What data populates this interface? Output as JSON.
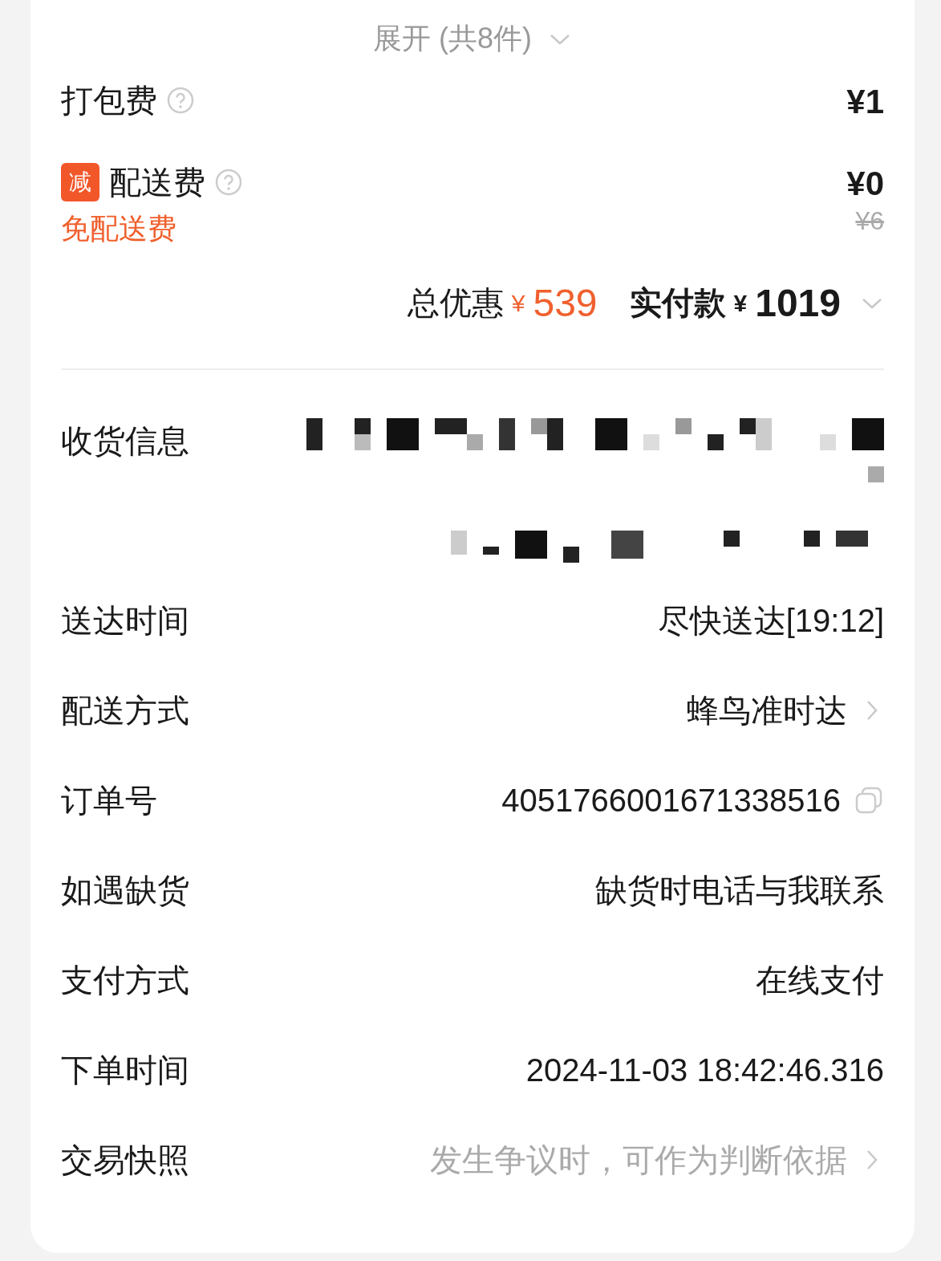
{
  "expand": {
    "label": "展开 (共8件)"
  },
  "fees": [
    {
      "label": "打包费",
      "amount": "¥1"
    },
    {
      "label": "配送费",
      "badge": "减",
      "note": "免配送费",
      "amount": "¥0",
      "original_amount": "¥6"
    }
  ],
  "summary": {
    "discount_label": "总优惠",
    "discount_currency": "¥",
    "discount": "539",
    "paid_label": "实付款",
    "paid_currency": "¥",
    "paid": "1019"
  },
  "info": [
    {
      "label": "收货信息",
      "kind": "redacted"
    },
    {
      "label": "送达时间",
      "kind": "plain",
      "value": "尽快送达[19:12]"
    },
    {
      "label": "配送方式",
      "kind": "link",
      "value": "蜂鸟准时达"
    },
    {
      "label": "订单号",
      "kind": "copy",
      "value": "4051766001671338516"
    },
    {
      "label": "如遇缺货",
      "kind": "plain",
      "value": "缺货时电话与我联系"
    },
    {
      "label": "支付方式",
      "kind": "plain",
      "value": "在线支付"
    },
    {
      "label": "下单时间",
      "kind": "plain",
      "value": "2024-11-03 18:42:46.316"
    },
    {
      "label": "交易快照",
      "kind": "hint",
      "value": "发生争议时，可作为判断依据"
    }
  ]
}
